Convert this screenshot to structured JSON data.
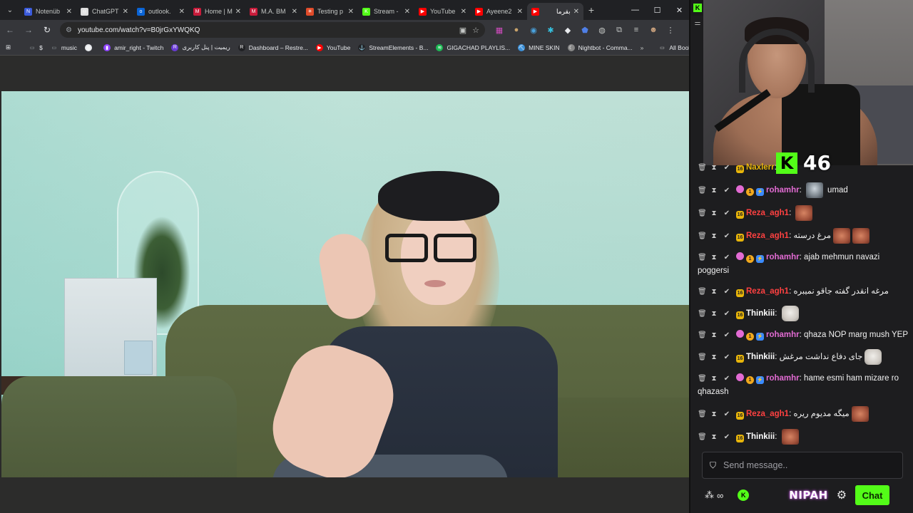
{
  "browser": {
    "tabs": [
      {
        "title": "Notenüb",
        "favicon_color": "#3b5bdb",
        "favicon": "N"
      },
      {
        "title": "ChatGPT",
        "favicon_color": "#dddddd",
        "favicon": "◎"
      },
      {
        "title": "outlook.",
        "favicon_color": "#0a64d6",
        "favicon": "o"
      },
      {
        "title": "Home | M",
        "favicon_color": "#c81b3a",
        "favicon": "M"
      },
      {
        "title": "M.A. BM",
        "favicon_color": "#c81b3a",
        "favicon": "M"
      },
      {
        "title": "Testing p",
        "favicon_color": "#e04b2a",
        "favicon": "✳"
      },
      {
        "title": "Stream -",
        "favicon_color": "#53fc18",
        "favicon": "K"
      },
      {
        "title": "YouTube",
        "favicon_color": "#ff0000",
        "favicon": "▶"
      },
      {
        "title": "Ayeene2",
        "favicon_color": "#ff0000",
        "favicon": "▶"
      },
      {
        "title": "بقرما",
        "favicon_color": "#ff0000",
        "favicon": "▶",
        "active": true
      }
    ],
    "new_tab": "+",
    "window_controls": {
      "minimize": "—",
      "maximize": "☐",
      "close": "✕"
    },
    "url": "youtube.com/watch?v=B0jrGxYWQKQ",
    "bookmarks": [
      {
        "label": "$",
        "icon": "folder-icon",
        "color": "#9aa0a6"
      },
      {
        "label": "music",
        "icon": "folder-icon",
        "color": "#9aa0a6"
      },
      {
        "label": "",
        "icon": "globe-icon",
        "color": "#e8eaed"
      },
      {
        "label": "amir_right - Twitch",
        "icon": "twitch-icon",
        "color": "#9146ff"
      },
      {
        "label": "ریمیت | پنل کاربری",
        "icon": "remit-icon",
        "color": "#6a3bd6"
      },
      {
        "label": "Dashboard – Restre...",
        "icon": "restream-icon",
        "color": "#202124"
      },
      {
        "label": "YouTube",
        "icon": "youtube-icon",
        "color": "#ff0000"
      },
      {
        "label": "StreamElements - B...",
        "icon": "streamelements-icon",
        "color": "#202124"
      },
      {
        "label": "GIGACHAD PLAYLIS...",
        "icon": "spotify-icon",
        "color": "#1db954"
      },
      {
        "label": "MINE SKIN",
        "icon": "mineskin-icon",
        "color": "#3a8fd8"
      },
      {
        "label": "Nightbot - Comma...",
        "icon": "nightbot-icon",
        "color": "#888888"
      }
    ],
    "all_bookmarks": "All Bookmarks"
  },
  "stream": {
    "goal_count": "46"
  },
  "chat": {
    "messages": [
      {
        "user": "Naxlerr",
        "color": "#e8b50a",
        "badges": [
          "sub"
        ],
        "text": "",
        "emotes": []
      },
      {
        "user": "rohamhr",
        "color": "#e26bd3",
        "badges": [
          "pink",
          "gold",
          "blue"
        ],
        "text": "umad",
        "emotes": [
          "dude"
        ],
        "emote_first": true
      },
      {
        "user": "Reza_agh1",
        "color": "#ff4141",
        "badges": [
          "sub"
        ],
        "text": "",
        "emotes": [
          "face"
        ]
      },
      {
        "user": "Reza_agh1",
        "color": "#ff4141",
        "badges": [
          "sub"
        ],
        "text": "مرغ درسته",
        "emotes": [
          "face",
          "face"
        ]
      },
      {
        "user": "rohamhr",
        "color": "#e26bd3",
        "badges": [
          "pink",
          "gold",
          "blue"
        ],
        "text": "ajab mehmun navazi poggersi",
        "emotes": []
      },
      {
        "user": "Reza_agh1",
        "color": "#ff4141",
        "badges": [
          "sub"
        ],
        "text": "مرغه انقدر گفته جاقو نمیبره",
        "emotes": []
      },
      {
        "user": "Thinkiii",
        "color": "#ffffff",
        "badges": [
          "sub"
        ],
        "text": "",
        "emotes": [
          "cat"
        ]
      },
      {
        "user": "rohamhr",
        "color": "#e26bd3",
        "badges": [
          "pink",
          "gold",
          "blue"
        ],
        "text": "qhaza NOP marg mush YEP",
        "emotes": []
      },
      {
        "user": "Thinkiii",
        "color": "#ffffff",
        "badges": [
          "sub"
        ],
        "text": "جای دفاع نداشت مرغش",
        "emotes": [
          "cat"
        ]
      },
      {
        "user": "rohamhr",
        "color": "#e26bd3",
        "badges": [
          "pink",
          "gold",
          "blue"
        ],
        "text": "hame esmi ham mizare ro qhazash",
        "emotes": []
      },
      {
        "user": "Reza_agh1",
        "color": "#ff4141",
        "badges": [
          "sub"
        ],
        "text": "میگه مدیوم ریره",
        "emotes": [
          "face"
        ]
      },
      {
        "user": "Thinkiii",
        "color": "#ffffff",
        "badges": [
          "sub"
        ],
        "text": "",
        "emotes": [
          "face"
        ]
      }
    ],
    "send_placeholder": "Send message..",
    "footer": {
      "infinity": "∞",
      "brand": "NIPAH",
      "chat_button": "Chat"
    }
  }
}
